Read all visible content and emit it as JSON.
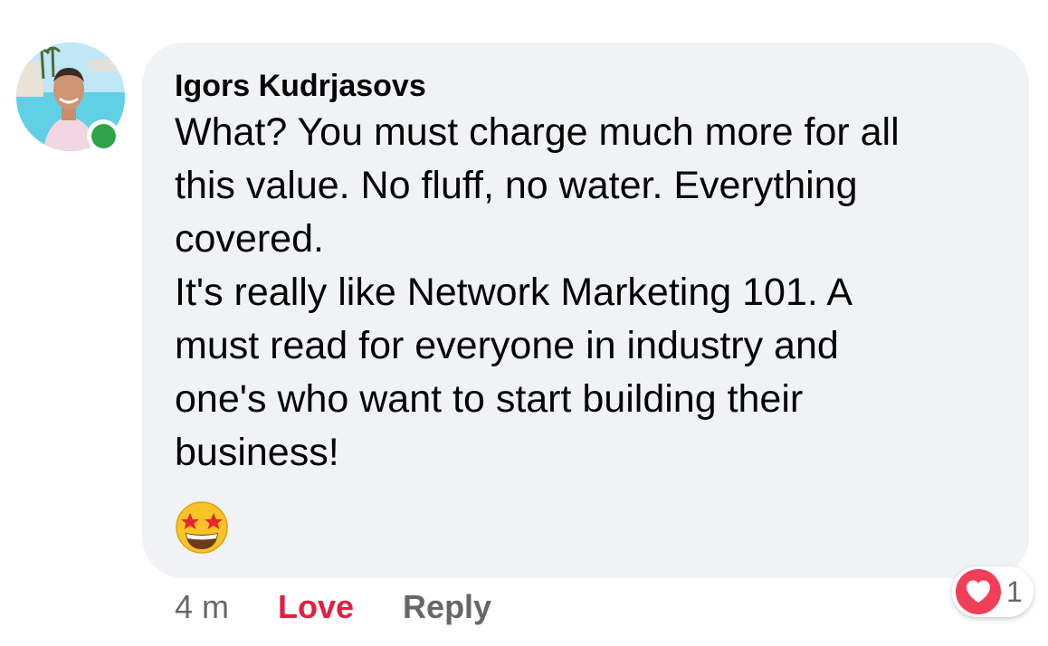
{
  "comment": {
    "author": "Igors Kudrjasovs",
    "text": "What? You must charge much more for all\nthis value. No fluff, no water. Everything\ncovered.\nIt's really like Network Marketing 101. A\nmust read for everyone in industry and\none's who want to start building their\nbusiness!",
    "emoji": "star-struck-emoji",
    "online_status": "online"
  },
  "actions": {
    "timestamp": "4 m",
    "love_label": "Love",
    "reply_label": "Reply"
  },
  "reactions": {
    "icon": "heart-icon",
    "count": "1"
  },
  "colors": {
    "bubble": "#f0f2f5",
    "love": "#e41e3f",
    "meta": "#65676b",
    "online": "#31a24c",
    "heart": "#f33e58"
  }
}
